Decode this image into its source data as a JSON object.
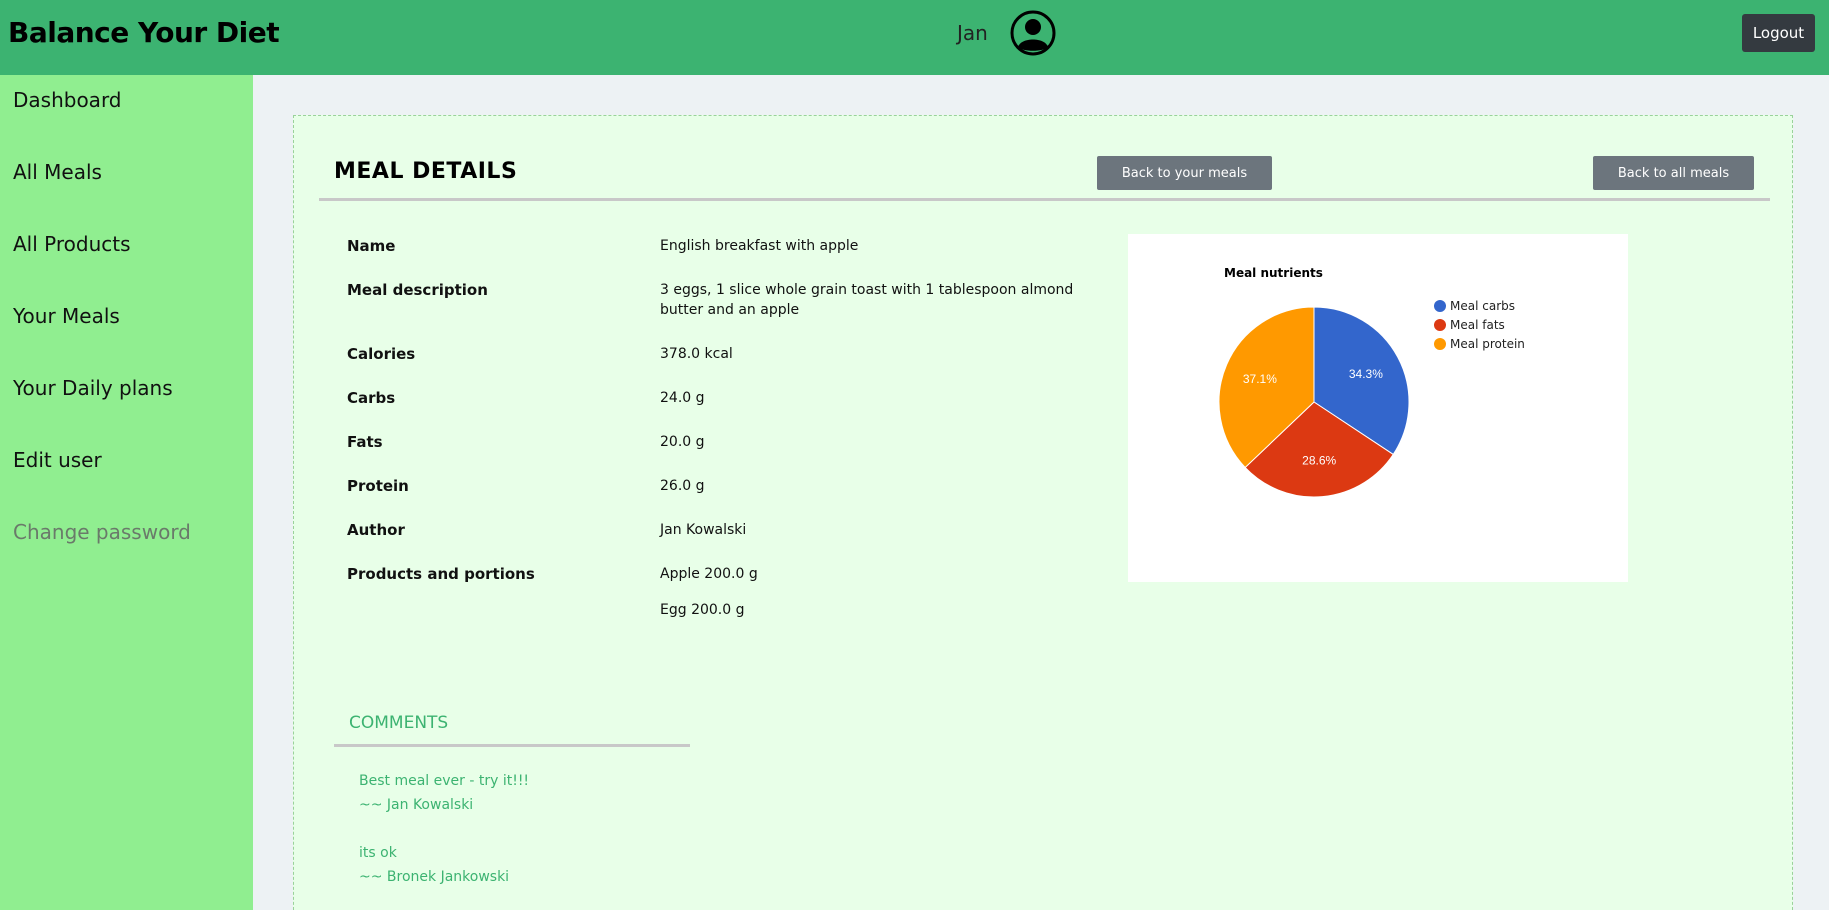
{
  "header": {
    "brand": "Balance Your Diet",
    "user_name": "Jan",
    "logout_label": "Logout"
  },
  "sidebar": {
    "items": [
      {
        "label": "Dashboard"
      },
      {
        "label": "All Meals"
      },
      {
        "label": "All Products"
      },
      {
        "label": "Your Meals"
      },
      {
        "label": "Your Daily plans"
      },
      {
        "label": "Edit user"
      },
      {
        "label": "Change password"
      }
    ]
  },
  "meal": {
    "section_title": "MEAL DETAILS",
    "back_your_label": "Back to your meals",
    "back_all_label": "Back to all meals",
    "fields": {
      "name_label": "Name",
      "name_value": "English breakfast with apple",
      "description_label": "Meal description",
      "description_value": "3 eggs, 1 slice whole grain toast with 1 tablespoon almond butter and an apple",
      "calories_label": "Calories",
      "calories_value": "378.0 kcal",
      "carbs_label": "Carbs",
      "carbs_value": "24.0 g",
      "fats_label": "Fats",
      "fats_value": "20.0 g",
      "protein_label": "Protein",
      "protein_value": "26.0 g",
      "author_label": "Author",
      "author_value": "Jan Kowalski",
      "products_label": "Products and portions",
      "products": [
        "Apple 200.0 g",
        "Egg 200.0 g"
      ]
    }
  },
  "chart_data": {
    "type": "pie",
    "title": "Meal nutrients",
    "labels": [
      "Meal carbs",
      "Meal fats",
      "Meal protein"
    ],
    "values": [
      34.3,
      28.6,
      37.1
    ],
    "value_labels": [
      "34.3%",
      "28.6%",
      "37.1%"
    ],
    "colors": [
      "#3366cc",
      "#dc3912",
      "#ff9900"
    ],
    "legend": "right"
  },
  "comments": {
    "title": "COMMENTS",
    "items": [
      {
        "text": "Best meal ever - try it!!!",
        "author": "~~ Jan Kowalski"
      },
      {
        "text": "its ok",
        "author": "~~ Bronek Jankowski"
      }
    ]
  }
}
